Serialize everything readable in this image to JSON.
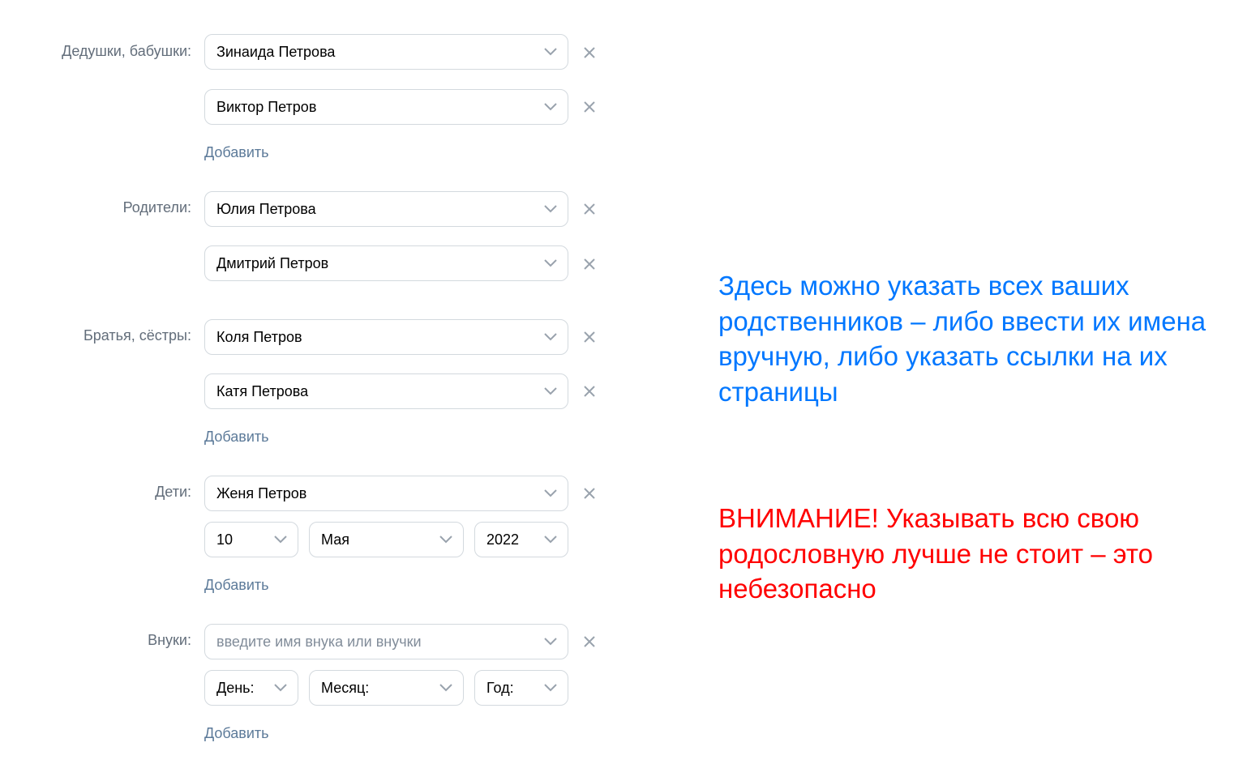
{
  "sections": {
    "grandparents": {
      "label": "Дедушки, бабушки:",
      "entries": [
        "Зинаида Петрова",
        "Виктор Петров"
      ],
      "add_label": "Добавить"
    },
    "parents": {
      "label": "Родители:",
      "entries": [
        "Юлия Петрова",
        "Дмитрий Петров"
      ]
    },
    "siblings": {
      "label": "Братья, сёстры:",
      "entries": [
        "Коля Петров",
        "Катя Петрова"
      ],
      "add_label": "Добавить"
    },
    "children": {
      "label": "Дети:",
      "entries": [
        "Женя Петров"
      ],
      "birth": {
        "day": "10",
        "month": "Мая",
        "year": "2022"
      },
      "add_label": "Добавить"
    },
    "grandchildren": {
      "label": "Внуки:",
      "placeholder": "введите имя внука или внучки",
      "birth": {
        "day": "День:",
        "month": "Месяц:",
        "year": "Год:"
      },
      "add_label": "Добавить"
    }
  },
  "notes": {
    "info": "Здесь можно указать всех ваших родственников – либо ввести их имена вручную, либо указать ссылки на их страницы",
    "warning": "ВНИМАНИЕ! Указывать всю свою родословную лучше не стоит – это небезопасно"
  },
  "colors": {
    "info_text": "#0077ff",
    "warning_text": "#ff0000",
    "link": "#5c7a99",
    "label": "#626d7a",
    "border": "#d3d9de"
  },
  "icons": {
    "dropdown": "chevron-down-icon",
    "remove": "close-icon"
  }
}
